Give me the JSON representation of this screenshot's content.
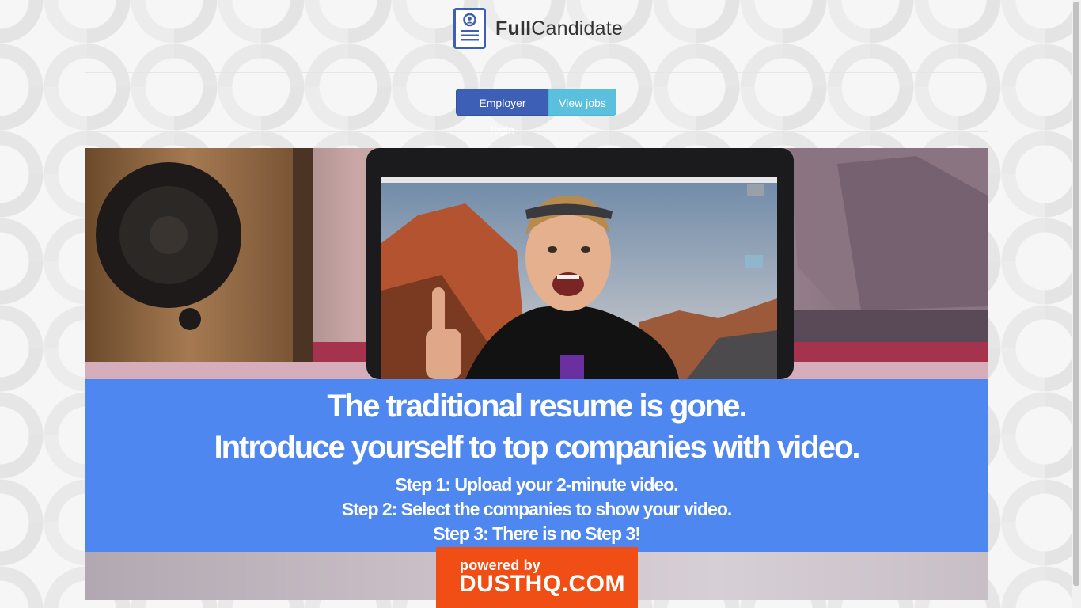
{
  "brand": {
    "name_bold": "Full",
    "name_regular": "Candidate",
    "accent": "#3e5fb6"
  },
  "nav": {
    "employer_login": "Employer login",
    "view_jobs": "View jobs",
    "employer_color": "#3e5fb6",
    "jobs_color": "#5bc0de"
  },
  "hero": {
    "headline_1": "The traditional resume is gone.",
    "headline_2": "Introduce yourself to top companies  with video.",
    "steps": [
      "Step 1: Upload your 2-minute video.",
      "Step 2: Select  the companies to show your video.",
      "Step 3: There is no  Step  3!"
    ],
    "panel_color": "#4f87f0",
    "image": "photo of a smiling man giving a thumbs-up in front of a laptop, with a speaker on the left"
  },
  "powered_by": {
    "small": "powered by",
    "big": "DUSTHQ.COM",
    "color": "#f04e14"
  },
  "icons": {
    "logo": "resume-document-icon"
  }
}
